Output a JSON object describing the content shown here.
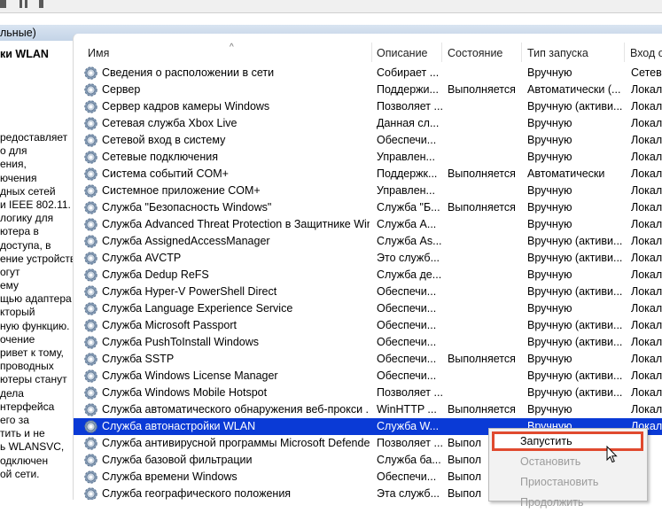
{
  "toolbar": {
    "buttons": [
      "stop-button",
      "pause-button",
      "restart-button"
    ]
  },
  "scope": {
    "label": "льные)"
  },
  "description": {
    "title": "ки WLAN",
    "lines": [
      "редоставляет",
      "о для",
      "ения,",
      "ючения",
      "дных сетей",
      "и IEEE 802.11.",
      "логику для",
      "ютера в",
      "доступа, в",
      "ение устройства",
      "огут",
      "ему",
      "щью адаптера",
      "кторый",
      "ную функцию.",
      "очение",
      "ривет к тому,",
      "проводных",
      "ютеры станут",
      "дела",
      "нтерфейса",
      "его за",
      "тить и не",
      "ь WLANSVC,",
      "одключен",
      "ой сети."
    ]
  },
  "columns": {
    "name": "Имя",
    "description": "Описание",
    "state": "Состояние",
    "startup": "Тип запуска",
    "logon": "Вход от"
  },
  "services": [
    {
      "name": "Сведения о расположении в сети",
      "desc": "Собирает ...",
      "state": "",
      "startup": "Вручную",
      "logon": "Сетевая"
    },
    {
      "name": "Сервер",
      "desc": "Поддержи...",
      "state": "Выполняется",
      "startup": "Автоматически (...",
      "logon": "Локаль"
    },
    {
      "name": "Сервер кадров камеры Windows",
      "desc": "Позволяет ...",
      "state": "",
      "startup": "Вручную (активи...",
      "logon": "Локаль"
    },
    {
      "name": "Сетевая служба Xbox Live",
      "desc": "Данная сл...",
      "state": "",
      "startup": "Вручную",
      "logon": "Локаль"
    },
    {
      "name": "Сетевой вход в систему",
      "desc": "Обеспечи...",
      "state": "",
      "startup": "Вручную",
      "logon": "Локаль"
    },
    {
      "name": "Сетевые подключения",
      "desc": "Управлен...",
      "state": "",
      "startup": "Вручную",
      "logon": "Локаль"
    },
    {
      "name": "Система событий COM+",
      "desc": "Поддержк...",
      "state": "Выполняется",
      "startup": "Автоматически",
      "logon": "Локаль"
    },
    {
      "name": "Системное приложение COM+",
      "desc": "Управлен...",
      "state": "",
      "startup": "Вручную",
      "logon": "Локаль"
    },
    {
      "name": "Служба \"Безопасность Windows\"",
      "desc": "Служба \"Б...",
      "state": "Выполняется",
      "startup": "Вручную",
      "logon": "Локаль"
    },
    {
      "name": "Служба Advanced Threat Protection в Защитнике Win...",
      "desc": "Служба A...",
      "state": "",
      "startup": "Вручную",
      "logon": "Локаль"
    },
    {
      "name": "Служба AssignedAccessManager",
      "desc": "Служба As...",
      "state": "",
      "startup": "Вручную (активи...",
      "logon": "Локаль"
    },
    {
      "name": "Служба AVCTP",
      "desc": "Это служб...",
      "state": "",
      "startup": "Вручную (активи...",
      "logon": "Локаль"
    },
    {
      "name": "Служба Dedup ReFS",
      "desc": "Служба де...",
      "state": "",
      "startup": "Вручную",
      "logon": "Локаль"
    },
    {
      "name": "Служба Hyper-V PowerShell Direct",
      "desc": "Обеспечи...",
      "state": "",
      "startup": "Вручную (активи...",
      "logon": "Локаль"
    },
    {
      "name": "Служба Language Experience Service",
      "desc": "Обеспечи...",
      "state": "",
      "startup": "Вручную",
      "logon": "Локаль"
    },
    {
      "name": "Служба Microsoft Passport",
      "desc": "Обеспечи...",
      "state": "",
      "startup": "Вручную (активи...",
      "logon": "Локаль"
    },
    {
      "name": "Служба PushToInstall Windows",
      "desc": "Обеспечи...",
      "state": "",
      "startup": "Вручную (активи...",
      "logon": "Локаль"
    },
    {
      "name": "Служба SSTP",
      "desc": "Обеспечи...",
      "state": "Выполняется",
      "startup": "Вручную",
      "logon": "Локаль"
    },
    {
      "name": "Служба Windows License Manager",
      "desc": "Обеспечи...",
      "state": "",
      "startup": "Вручную (активи...",
      "logon": "Локаль"
    },
    {
      "name": "Служба Windows Mobile Hotspot",
      "desc": "Позволяет ...",
      "state": "",
      "startup": "Вручную (активи...",
      "logon": "Локаль"
    },
    {
      "name": "Служба автоматического обнаружения веб-прокси ...",
      "desc": "WinHTTP ...",
      "state": "Выполняется",
      "startup": "Вручную",
      "logon": "Локаль"
    },
    {
      "name": "Служба автонастройки WLAN",
      "desc": "Служба W...",
      "state": "",
      "startup": "Вручную",
      "logon": "Локаль",
      "selected": true
    },
    {
      "name": "Служба антивирусной программы Microsoft Defender",
      "desc": "Позволяет ...",
      "state": "Выпол",
      "startup": "",
      "logon": ""
    },
    {
      "name": "Служба базовой фильтрации",
      "desc": "Служба ба...",
      "state": "Выпол",
      "startup": "",
      "logon": ""
    },
    {
      "name": "Служба времени Windows",
      "desc": "Обеспечи...",
      "state": "Выпол",
      "startup": "",
      "logon": ""
    },
    {
      "name": "Служба географического положения",
      "desc": "Эта служб...",
      "state": "Выпол",
      "startup": "",
      "logon": ""
    }
  ],
  "context_menu": {
    "items": [
      {
        "label": "Запустить",
        "disabled": false
      },
      {
        "label": "Остановить",
        "disabled": true
      },
      {
        "label": "Приостановить",
        "disabled": true
      },
      {
        "label": "Продолжить",
        "disabled": true
      }
    ]
  },
  "colors": {
    "selection": "#0a3ad6",
    "menu_highlight_border": "#e04a2f",
    "gear": "#7e93ad"
  },
  "icons": {
    "service": "gear-icon",
    "cursor": "mouse-pointer-icon"
  }
}
